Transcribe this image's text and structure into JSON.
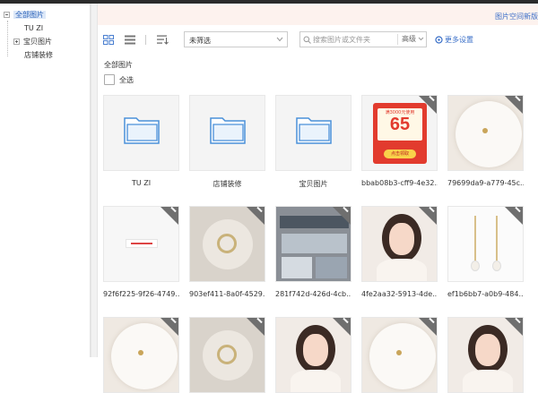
{
  "sidebar": {
    "root_label": "全部图片",
    "children": [
      {
        "label": "TU ZI",
        "expandable": false
      },
      {
        "label": "宝贝图片",
        "expandable": true
      },
      {
        "label": "店铺装修",
        "expandable": false
      }
    ]
  },
  "notice": {
    "text": "图片空间新版"
  },
  "toolbar": {
    "view_grid_icon": "grid-view-icon",
    "view_list_icon": "list-view-icon",
    "sort_icon": "sort-icon",
    "filter_value": "未筛选",
    "search_placeholder": "搜索图片或文件夹",
    "advanced_label": "高级",
    "more_settings_label": "更多设置"
  },
  "breadcrumb": "全部图片",
  "select_all_label": "全选",
  "items": [
    {
      "type": "folder",
      "caption": "TU ZI"
    },
    {
      "type": "folder",
      "caption": "店铺装修"
    },
    {
      "type": "folder",
      "caption": "宝贝图片"
    },
    {
      "type": "image",
      "caption": "bbab08b3-cff9-4e32...",
      "kind": "coupon",
      "coupon_top": "满3000元使用",
      "coupon_amount": "65",
      "coupon_btn": "点击领取"
    },
    {
      "type": "image",
      "caption": "79699da9-a779-45c...",
      "kind": "plate"
    },
    {
      "type": "image",
      "caption": "92f6f225-9f26-4749...",
      "kind": "banner"
    },
    {
      "type": "image",
      "caption": "903ef411-8a0f-4529...",
      "kind": "ring"
    },
    {
      "type": "image",
      "caption": "281f742d-426d-4cb...",
      "kind": "store"
    },
    {
      "type": "image",
      "caption": "4fe2aa32-5913-4de...",
      "kind": "portrait"
    },
    {
      "type": "image",
      "caption": "ef1b6bb7-a0b9-484...",
      "kind": "earring"
    },
    {
      "type": "image",
      "caption": "",
      "kind": "plate"
    },
    {
      "type": "image",
      "caption": "",
      "kind": "ring"
    },
    {
      "type": "image",
      "caption": "",
      "kind": "portrait"
    },
    {
      "type": "image",
      "caption": "",
      "kind": "plate"
    },
    {
      "type": "image",
      "caption": "",
      "kind": "portrait"
    }
  ]
}
